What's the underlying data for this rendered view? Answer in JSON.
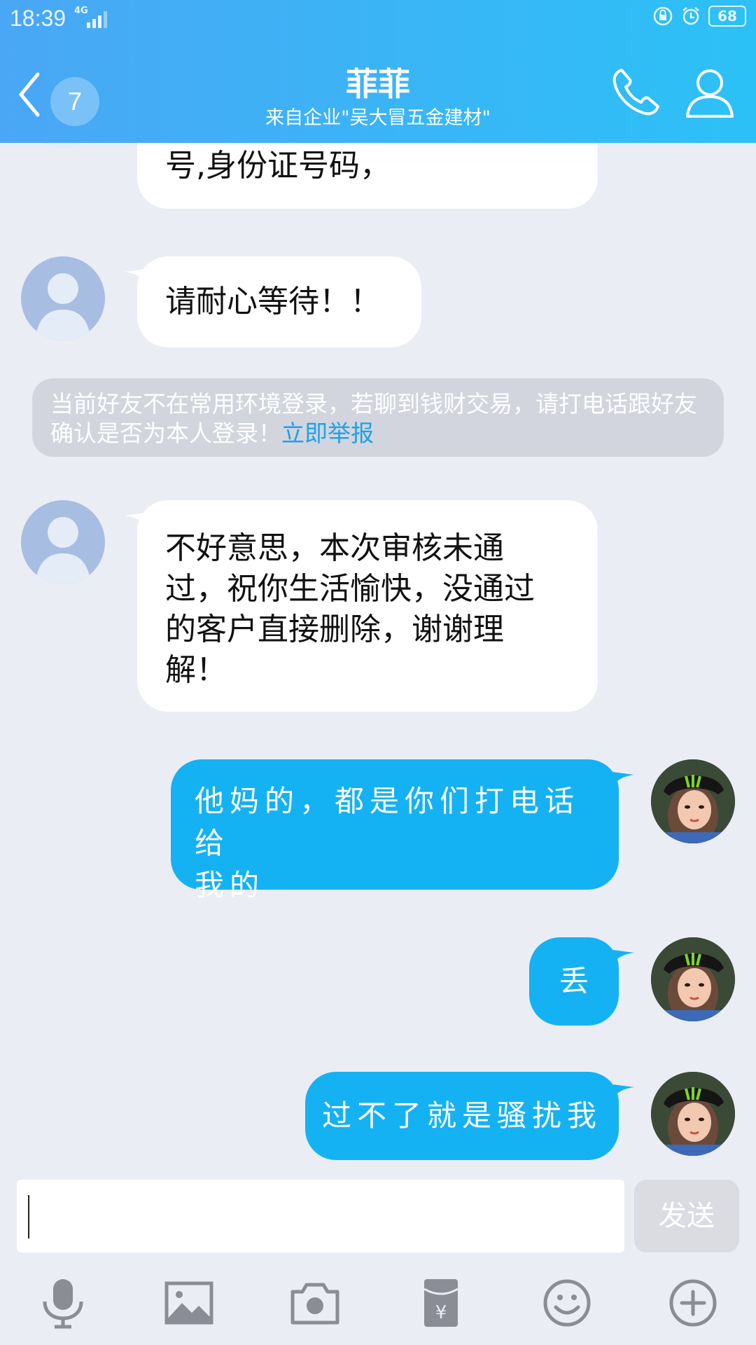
{
  "status_bar": {
    "time": "18:39",
    "network": "4G",
    "battery": "68"
  },
  "header": {
    "unread_count": "7",
    "title": "菲菲",
    "subtitle": "来自企业\"吴大冒五金建材\""
  },
  "messages": [
    {
      "side": "in",
      "text": "号,身份证号码，"
    },
    {
      "side": "in",
      "text": "请耐心等待！！"
    },
    {
      "side": "in",
      "lines": [
        " 不好意思，本次审核未通",
        "过，祝你生活愉快，没通过",
        "的客户直接删除，谢谢理",
        "解！"
      ]
    },
    {
      "side": "out",
      "lines": [
        "他妈的，都是你们打电话给",
        "我的"
      ]
    },
    {
      "side": "out",
      "text": "丢"
    },
    {
      "side": "out",
      "text": "过不了就是骚扰我"
    }
  ],
  "notice": {
    "text": "当前好友不在常用环境登录，若聊到钱财交易，请打电话跟好友确认是否为本人登录！",
    "link": "立即举报"
  },
  "input": {
    "value": "",
    "send_label": "发送"
  },
  "toolbar": {
    "icons": [
      "microphone-icon",
      "image-icon",
      "camera-icon",
      "red-packet-icon",
      "emoji-icon",
      "plus-icon"
    ]
  },
  "colors": {
    "header_start": "#4aa7f5",
    "header_end": "#2cc1f6",
    "outgoing_bubble": "#14b2f3",
    "incoming_bubble": "#ffffff",
    "link": "#1ca2ea",
    "background": "#ebedf5"
  }
}
